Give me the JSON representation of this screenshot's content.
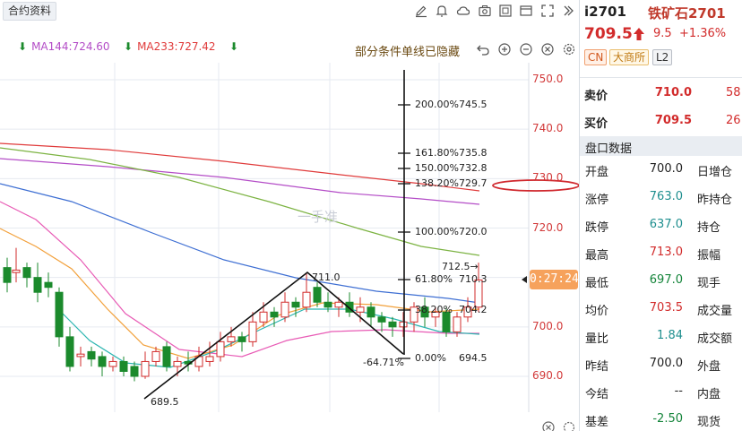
{
  "toolbar": {
    "contract_info_label": "合约资料",
    "icons": [
      "pen-icon",
      "bell-icon",
      "cloud-icon",
      "camera-icon",
      "layout-icon",
      "window-icon",
      "fullscreen-icon",
      "collapse-icon"
    ]
  },
  "indicators": {
    "ma144": "MA144:724.60",
    "ma233": "MA233:727.42",
    "note": "部分条件单线已隐藏",
    "colors": {
      "ma144": "#b44dc7",
      "ma233": "#e03b3b",
      "arrow": "#1b8a2c"
    }
  },
  "chart": {
    "watermark": "一手准",
    "price_ticks": [
      "750.0",
      "740.0",
      "730.0",
      "720.0",
      "710.0",
      "700.0",
      "690.0"
    ],
    "current_countdown": "0:27:24",
    "fib_levels": [
      {
        "pct": "200.00%",
        "value": "745.5"
      },
      {
        "pct": "161.80%",
        "value": "735.8"
      },
      {
        "pct": "150.00%",
        "value": "732.8"
      },
      {
        "pct": "138.20%",
        "value": "729.7"
      },
      {
        "pct": "100.00%",
        "value": "720.0"
      },
      {
        "pct": "61.80%",
        "value": "710.3"
      },
      {
        "pct": "38.20%",
        "value": "704.2"
      },
      {
        "pct": "0.00%",
        "value": "694.5"
      },
      {
        "pct": "-64.71%",
        "value": ""
      }
    ],
    "annotations": {
      "low_label": "689.5",
      "peak_label": "711.0",
      "last_high": "712.5→"
    }
  },
  "quote": {
    "code": "i2701",
    "name": "铁矿石2701",
    "price": "709.5",
    "change": "9.5",
    "change_pct": "+1.36%",
    "tags": [
      "CN",
      "大商所",
      "L2"
    ],
    "ask_label": "卖价",
    "ask_price": "710.0",
    "ask_vol": "58",
    "bid_label": "买价",
    "bid_price": "709.5",
    "bid_vol": "26",
    "section_title": "盘口数据",
    "rows": [
      {
        "label": "开盘",
        "value": "700.0",
        "label2": "日增仓"
      },
      {
        "label": "涨停",
        "value": "763.0",
        "label2": "昨持仓"
      },
      {
        "label": "跌停",
        "value": "637.0",
        "label2": "持仓"
      },
      {
        "label": "最高",
        "value": "713.0",
        "label2": "振幅"
      },
      {
        "label": "最低",
        "value": "697.0",
        "label2": "现手"
      },
      {
        "label": "均价",
        "value": "703.5",
        "label2": "成交量"
      },
      {
        "label": "量比",
        "value": "1.84",
        "label2": "成交额"
      },
      {
        "label": "昨结",
        "value": "700.0",
        "label2": "外盘"
      },
      {
        "label": "今结",
        "value": "--",
        "label2": "内盘"
      },
      {
        "label": "基差",
        "value": "-2.50",
        "label2": "现货"
      }
    ]
  }
}
